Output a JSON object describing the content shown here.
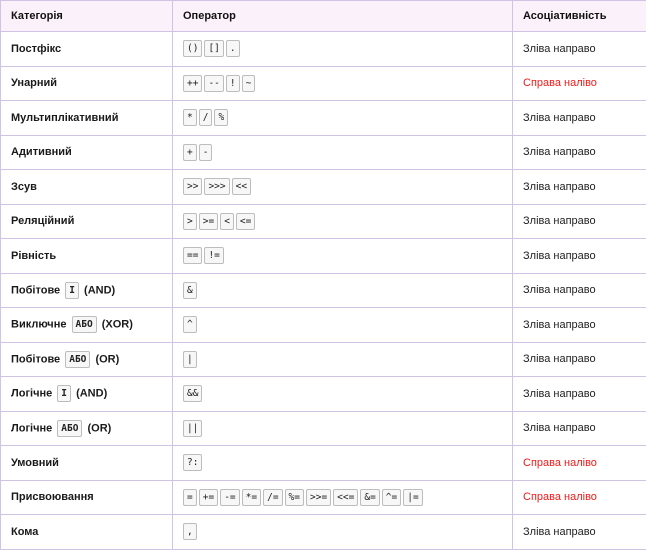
{
  "table": {
    "headers": [
      "Категорія",
      "Оператор",
      "Асоціативність"
    ],
    "rows": [
      {
        "category": [
          "Постфікс"
        ],
        "operators": [
          "()",
          "[]",
          "."
        ],
        "assoc": "Зліва направо",
        "rtl": false
      },
      {
        "category": [
          "Унарний"
        ],
        "operators": [
          "++",
          "--",
          "!",
          "~"
        ],
        "assoc": "Справа наліво",
        "rtl": true
      },
      {
        "category": [
          "Мультиплікативний"
        ],
        "operators": [
          "*",
          "/",
          "%"
        ],
        "assoc": "Зліва направо",
        "rtl": false
      },
      {
        "category": [
          "Адитивний"
        ],
        "operators": [
          "+",
          "-"
        ],
        "assoc": "Зліва направо",
        "rtl": false
      },
      {
        "category": [
          "Зсув"
        ],
        "operators": [
          ">>",
          ">>>",
          "<<"
        ],
        "assoc": "Зліва направо",
        "rtl": false
      },
      {
        "category": [
          "Реляційний"
        ],
        "operators": [
          ">",
          ">=",
          "<",
          "<="
        ],
        "assoc": "Зліва направо",
        "rtl": false
      },
      {
        "category": [
          "Рівність"
        ],
        "operators": [
          "==",
          "!="
        ],
        "assoc": "Зліва направо",
        "rtl": false
      },
      {
        "category": [
          "Побітове ",
          {
            "code": "І"
          },
          " (AND)"
        ],
        "operators": [
          "&"
        ],
        "assoc": "Зліва направо",
        "rtl": false
      },
      {
        "category": [
          "Виключне ",
          {
            "code": "АБО"
          },
          " (XOR)"
        ],
        "operators": [
          "^"
        ],
        "assoc": "Зліва направо",
        "rtl": false
      },
      {
        "category": [
          "Побітове ",
          {
            "code": "АБО"
          },
          " (OR)"
        ],
        "operators": [
          "|"
        ],
        "assoc": "Зліва направо",
        "rtl": false
      },
      {
        "category": [
          "Логічне ",
          {
            "code": "І"
          },
          " (AND)"
        ],
        "operators": [
          "&&"
        ],
        "assoc": "Зліва направо",
        "rtl": false
      },
      {
        "category": [
          "Логічне ",
          {
            "code": "АБО"
          },
          " (OR)"
        ],
        "operators": [
          "||"
        ],
        "assoc": "Зліва направо",
        "rtl": false
      },
      {
        "category": [
          "Умовний"
        ],
        "operators": [
          "?:"
        ],
        "assoc": "Справа наліво",
        "rtl": true
      },
      {
        "category": [
          "Присвоювання"
        ],
        "operators": [
          "=",
          "+=",
          "-=",
          "*=",
          "/=",
          "%=",
          ">>=",
          "<<=",
          "&=",
          "^=",
          "|="
        ],
        "assoc": "Справа наліво",
        "rtl": true
      },
      {
        "category": [
          "Кома"
        ],
        "operators": [
          ","
        ],
        "assoc": "Зліва направо",
        "rtl": false
      }
    ]
  },
  "colors": {
    "header_bg": "#fbf1fb",
    "border": "#cfc4e3",
    "rtl_text": "#ef1a1a"
  }
}
